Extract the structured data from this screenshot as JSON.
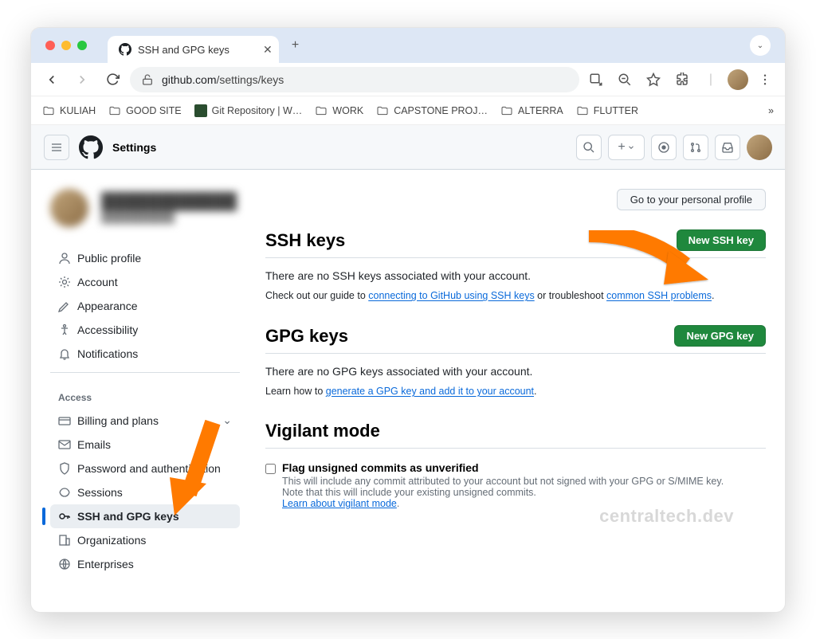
{
  "browser": {
    "tab_title": "SSH and GPG keys",
    "url_prefix": "github.com",
    "url_path": "/settings/keys",
    "bookmarks": [
      "KULIAH",
      "GOOD SITE",
      "Git Repository | W…",
      "WORK",
      "CAPSTONE PROJ…",
      "ALTERRA",
      "FLUTTER"
    ]
  },
  "github": {
    "header_title": "Settings",
    "profile_button": "Go to your personal profile",
    "sidebar": {
      "items_top": [
        "Public profile",
        "Account",
        "Appearance",
        "Accessibility",
        "Notifications"
      ],
      "access_heading": "Access",
      "items_access": [
        "Billing and plans",
        "Emails",
        "Password and authentication",
        "Sessions",
        "SSH and GPG keys",
        "Organizations",
        "Enterprises"
      ]
    },
    "ssh": {
      "title": "SSH keys",
      "button": "New SSH key",
      "body": "There are no SSH keys associated with your account.",
      "sub_prefix": "Check out our guide to ",
      "sub_link1": "connecting to GitHub using SSH keys",
      "sub_mid": " or troubleshoot ",
      "sub_link2": "common SSH problems",
      "sub_suffix": "."
    },
    "gpg": {
      "title": "GPG keys",
      "button": "New GPG key",
      "body": "There are no GPG keys associated with your account.",
      "sub_prefix": "Learn how to ",
      "sub_link": "generate a GPG key and add it to your account",
      "sub_suffix": "."
    },
    "vigilant": {
      "title": "Vigilant mode",
      "checkbox_label": "Flag unsigned commits as unverified",
      "desc_line1": "This will include any commit attributed to your account but not signed with your GPG or S/MIME key.",
      "desc_line2": "Note that this will include your existing unsigned commits.",
      "desc_link": "Learn about vigilant mode",
      "desc_suffix": "."
    }
  },
  "watermark": "centraltech.dev"
}
